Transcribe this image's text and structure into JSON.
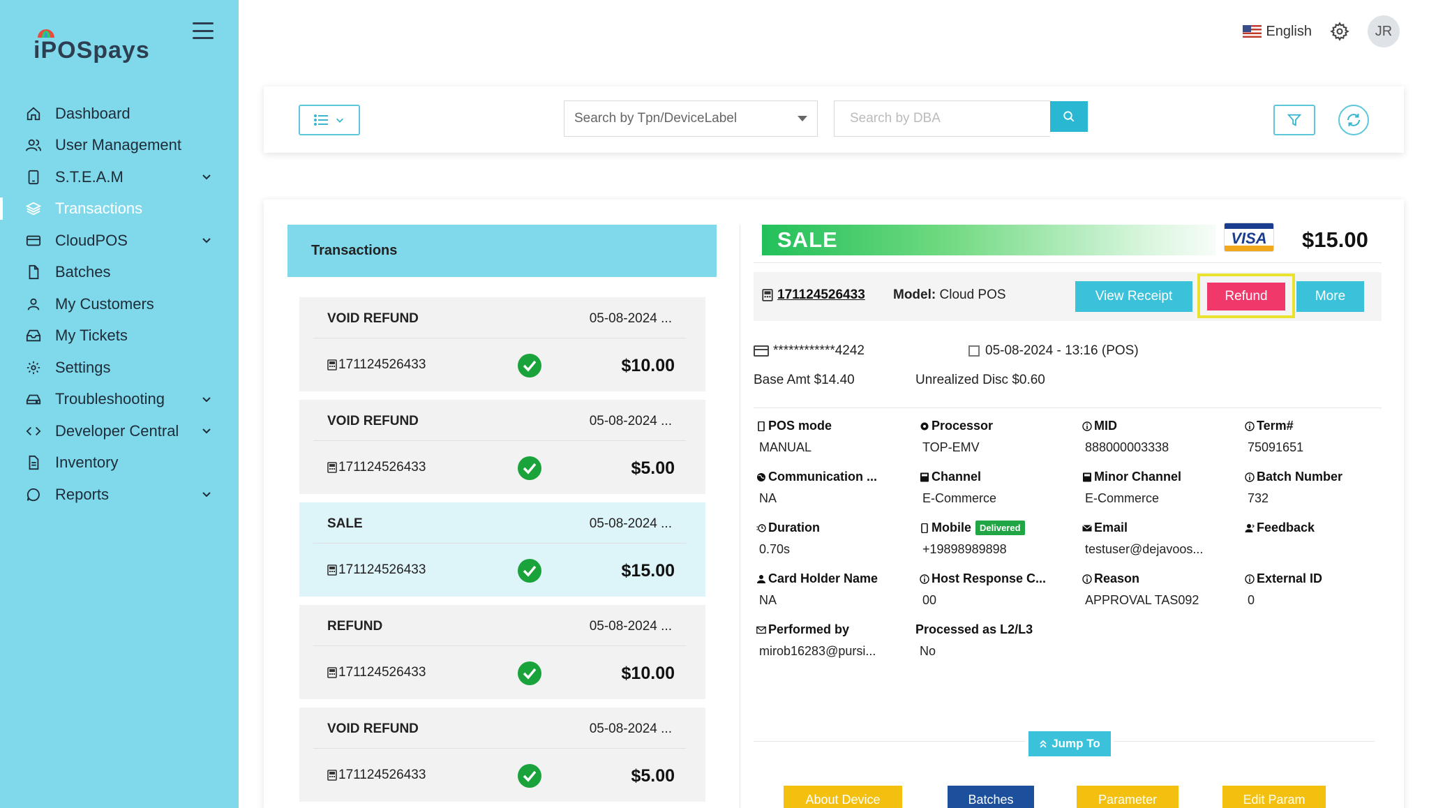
{
  "brand": {
    "logo_text": "iPOSpays"
  },
  "sidebar": {
    "items": [
      {
        "label": "Dashboard",
        "icon": "home-icon"
      },
      {
        "label": "User Management",
        "icon": "users-icon"
      },
      {
        "label": "S.T.E.A.M",
        "icon": "device-icon",
        "chevron": true
      },
      {
        "label": "Transactions",
        "icon": "layers-icon",
        "active": true
      },
      {
        "label": "CloudPOS",
        "icon": "card-icon",
        "chevron": true
      },
      {
        "label": "Batches",
        "icon": "file-icon"
      },
      {
        "label": "My Customers",
        "icon": "user-icon"
      },
      {
        "label": "My Tickets",
        "icon": "inbox-icon"
      },
      {
        "label": "Settings",
        "icon": "gear-icon"
      },
      {
        "label": "Troubleshooting",
        "icon": "drive-icon",
        "chevron": true
      },
      {
        "label": "Developer Central",
        "icon": "code-icon",
        "chevron": true
      },
      {
        "label": "Inventory",
        "icon": "document-icon"
      },
      {
        "label": "Reports",
        "icon": "chat-icon",
        "chevron": true
      }
    ]
  },
  "header": {
    "language": "English",
    "avatar_initials": "JR"
  },
  "search": {
    "tpn_placeholder": "Search by Tpn/DeviceLabel",
    "dba_placeholder": "Search by DBA"
  },
  "transactions": {
    "title": "Transactions",
    "items": [
      {
        "type": "VOID REFUND",
        "date": "05-08-2024 ...",
        "id": "171124526433",
        "amount": "$10.00"
      },
      {
        "type": "VOID REFUND",
        "date": "05-08-2024 ...",
        "id": "171124526433",
        "amount": "$5.00"
      },
      {
        "type": "SALE",
        "date": "05-08-2024 ...",
        "id": "171124526433",
        "amount": "$15.00",
        "selected": true
      },
      {
        "type": "REFUND",
        "date": "05-08-2024 ...",
        "id": "171124526433",
        "amount": "$10.00"
      },
      {
        "type": "VOID REFUND",
        "date": "05-08-2024 ...",
        "id": "171124526433",
        "amount": "$5.00"
      }
    ]
  },
  "detail": {
    "type": "SALE",
    "card_brand": "VISA",
    "amount": "$15.00",
    "tx_id": "171124526433",
    "model_label": "Model:",
    "model_value": "Cloud POS",
    "buttons": {
      "view_receipt": "View Receipt",
      "refund": "Refund",
      "more": "More"
    },
    "card_number": "************4242",
    "datetime": "05-08-2024 - 13:16 (POS)",
    "base_amt": "Base Amt $14.40",
    "unrealized": "Unrealized Disc $0.60",
    "fields": [
      {
        "label": "POS mode",
        "value": "MANUAL",
        "icon": "device-icon"
      },
      {
        "label": "Processor",
        "value": "TOP-EMV",
        "icon": "gear-icon"
      },
      {
        "label": "MID",
        "value": "888000003338",
        "icon": "info-icon"
      },
      {
        "label": "Term#",
        "value": "75091651",
        "icon": "info-icon"
      },
      {
        "label": "Communication ...",
        "value": "NA",
        "icon": "globe-icon"
      },
      {
        "label": "Channel",
        "value": "E-Commerce",
        "icon": "terminal-icon"
      },
      {
        "label": "Minor Channel",
        "value": "E-Commerce",
        "icon": "terminal-icon"
      },
      {
        "label": "Batch Number",
        "value": "732",
        "icon": "info-icon"
      },
      {
        "label": "Duration",
        "value": "0.70s",
        "icon": "clock-icon"
      },
      {
        "label": "Mobile",
        "value": "+19898989898",
        "icon": "mobile-icon",
        "badge": "Delivered"
      },
      {
        "label": "Email",
        "value": "testuser@dejavoos...",
        "icon": "mail-icon"
      },
      {
        "label": "Feedback",
        "value": "",
        "icon": "user-icon"
      },
      {
        "label": "Card Holder Name",
        "value": "NA",
        "icon": "user-icon"
      },
      {
        "label": "Host Response C...",
        "value": "00",
        "icon": "info-icon"
      },
      {
        "label": "Reason",
        "value": "APPROVAL TAS092",
        "icon": "info-icon"
      },
      {
        "label": "External ID",
        "value": "0",
        "icon": "info-icon"
      },
      {
        "label": "Performed by",
        "value": "mirob16283@pursi...",
        "icon": "mail-outline-icon"
      },
      {
        "label": "Processed as L2/L3",
        "value": "No",
        "icon": ""
      }
    ],
    "jump_to": "Jump To",
    "bottom_buttons": [
      "About Device",
      "Batches",
      "Parameter",
      "Edit Param"
    ]
  },
  "colors": {
    "sidebar_bg": "#7fd9ea",
    "accent": "#3bc1da",
    "refund": "#f0386b",
    "highlight": "#e9e22f",
    "success": "#21a645",
    "yellow_btn": "#f4c00f",
    "blue_btn": "#1c4f9c"
  }
}
